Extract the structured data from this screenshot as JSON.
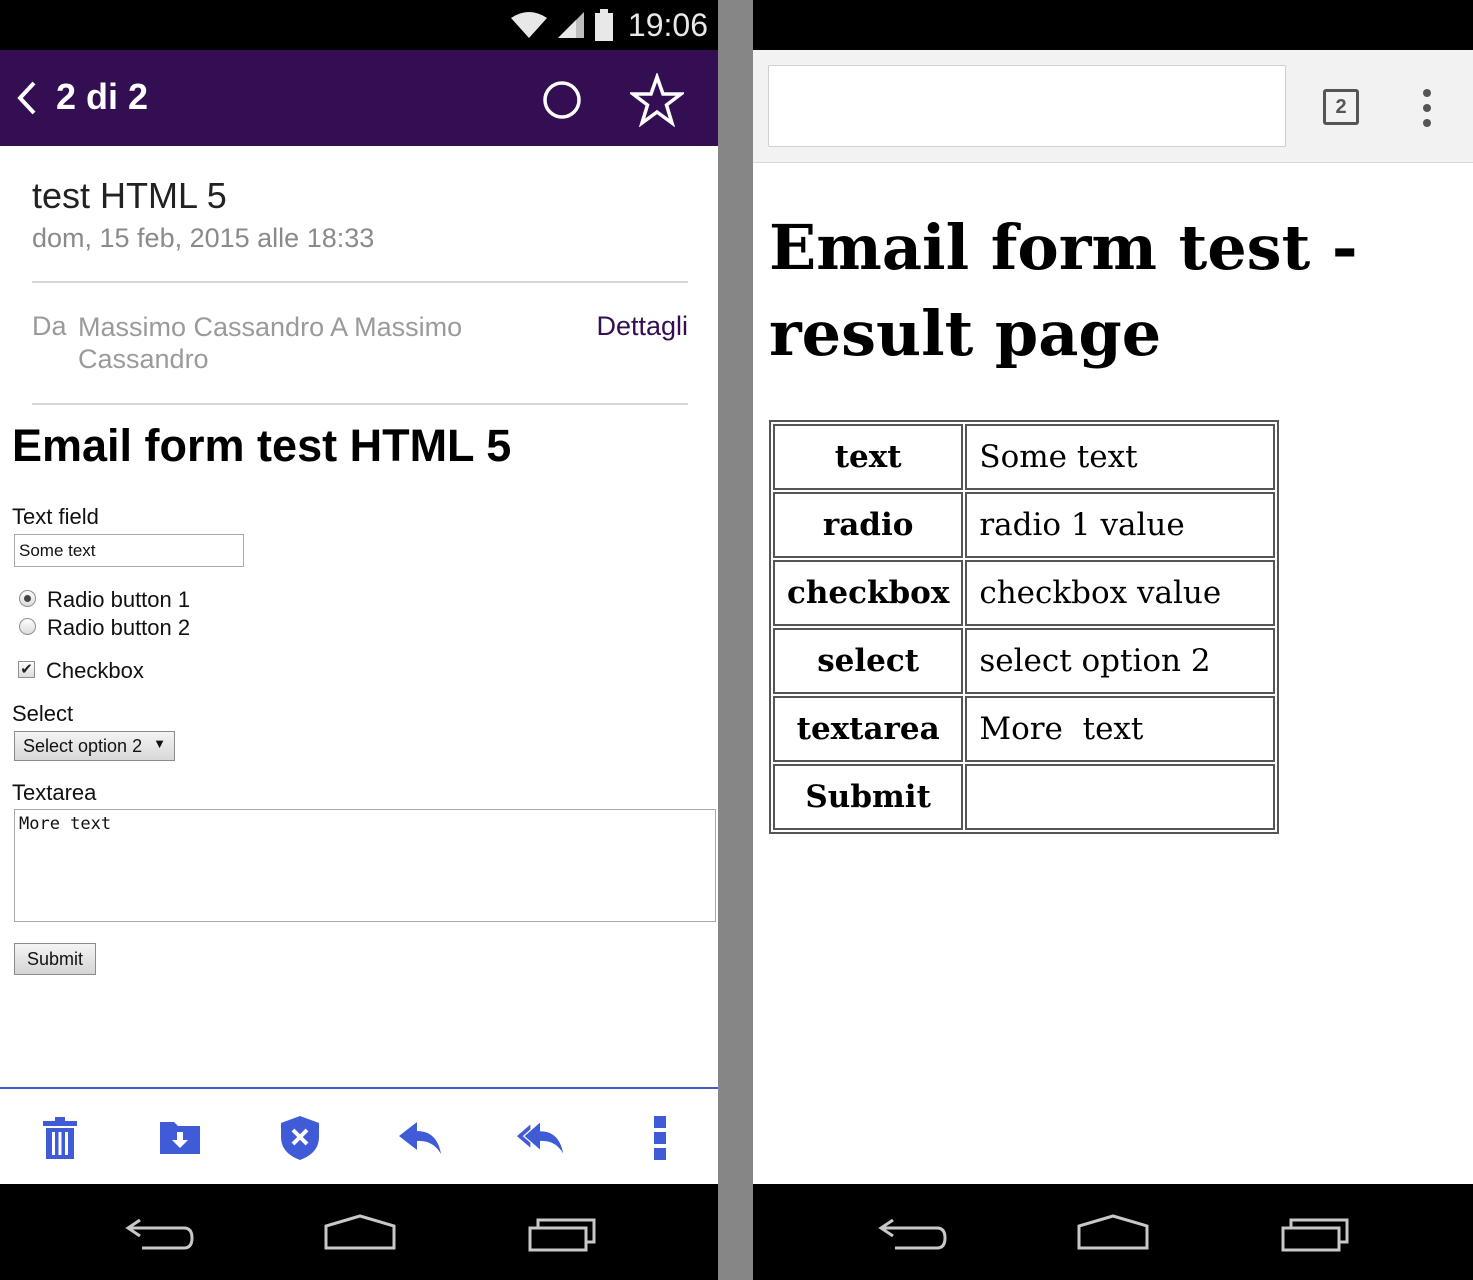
{
  "status_bar": {
    "time": "19:06"
  },
  "mail": {
    "header": {
      "title": "2 di 2"
    },
    "subject": "test HTML 5",
    "date": "dom, 15 feb, 2015 alle 18:33",
    "from_label": "Da",
    "from_value": "Massimo Cassandro A Massimo Cassandro",
    "details_link": "Dettagli",
    "form": {
      "title": "Email form test HTML 5",
      "text_field_label": "Text field",
      "text_field_value": "Some text",
      "radio_1_label": "Radio button 1",
      "radio_2_label": "Radio button 2",
      "checkbox_label": "Checkbox",
      "select_label": "Select",
      "select_value": "Select option 2",
      "textarea_label": "Textarea",
      "textarea_value": "More text",
      "submit_label": "Submit"
    },
    "toolbar": {
      "icons": [
        "trash-icon",
        "move-to-folder-icon",
        "spam-shield-icon",
        "reply-icon",
        "reply-all-icon",
        "overflow-menu-icon"
      ],
      "accent_color": "#3f5bd8"
    },
    "header_color": "#330e52"
  },
  "browser": {
    "tab_count": "2",
    "result_title": "Email form test - result page",
    "table": [
      {
        "key": "text",
        "value": "Some text"
      },
      {
        "key": "radio",
        "value": "radio 1 value"
      },
      {
        "key": "checkbox",
        "value": "checkbox value"
      },
      {
        "key": "select",
        "value": "select option 2"
      },
      {
        "key": "textarea",
        "value": "More  text"
      },
      {
        "key": "Submit",
        "value": ""
      }
    ]
  }
}
